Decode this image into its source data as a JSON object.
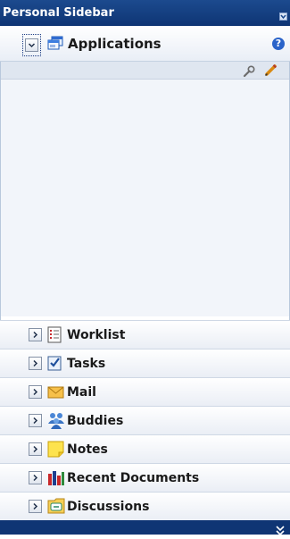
{
  "sidebar": {
    "title": "Personal Sidebar",
    "expanded": {
      "label": "Applications",
      "help": "?"
    },
    "items": [
      {
        "label": "Worklist",
        "icon": "worklist-icon"
      },
      {
        "label": "Tasks",
        "icon": "tasks-icon"
      },
      {
        "label": "Mail",
        "icon": "mail-icon"
      },
      {
        "label": "Buddies",
        "icon": "buddies-icon"
      },
      {
        "label": "Notes",
        "icon": "notes-icon"
      },
      {
        "label": "Recent Documents",
        "icon": "recent-documents-icon"
      },
      {
        "label": "Discussions",
        "icon": "discussions-icon"
      }
    ]
  },
  "colors": {
    "title_bar": "#0e3574",
    "section_bg": "#eaeef5",
    "content_bg": "#f2f5fa"
  }
}
